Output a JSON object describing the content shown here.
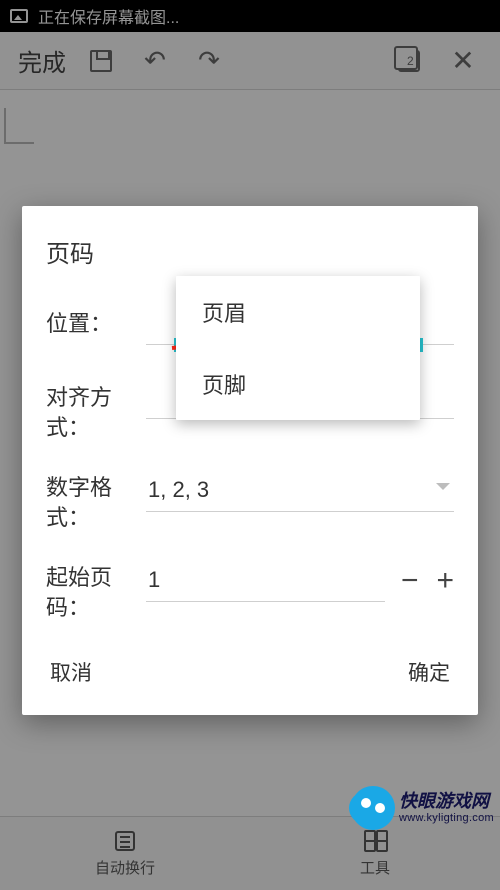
{
  "statusbar": {
    "text": "正在保存屏幕截图..."
  },
  "toolbar": {
    "done": "完成",
    "page_count": "2"
  },
  "dialog": {
    "title": "页码",
    "position_label": "位置：",
    "align_label": "对齐方式：",
    "align_value": "",
    "format_label": "数字格式：",
    "format_value": "1, 2, 3",
    "start_label": "起始页码：",
    "start_value": "1",
    "cancel": "取消",
    "confirm": "确定"
  },
  "dropdown": {
    "options": [
      "页眉",
      "页脚"
    ]
  },
  "bottombar": {
    "autowrap": "自动换行",
    "tools": "工具"
  },
  "watermark": {
    "title": "快眼游戏网",
    "url": "www.kyligting.com"
  }
}
